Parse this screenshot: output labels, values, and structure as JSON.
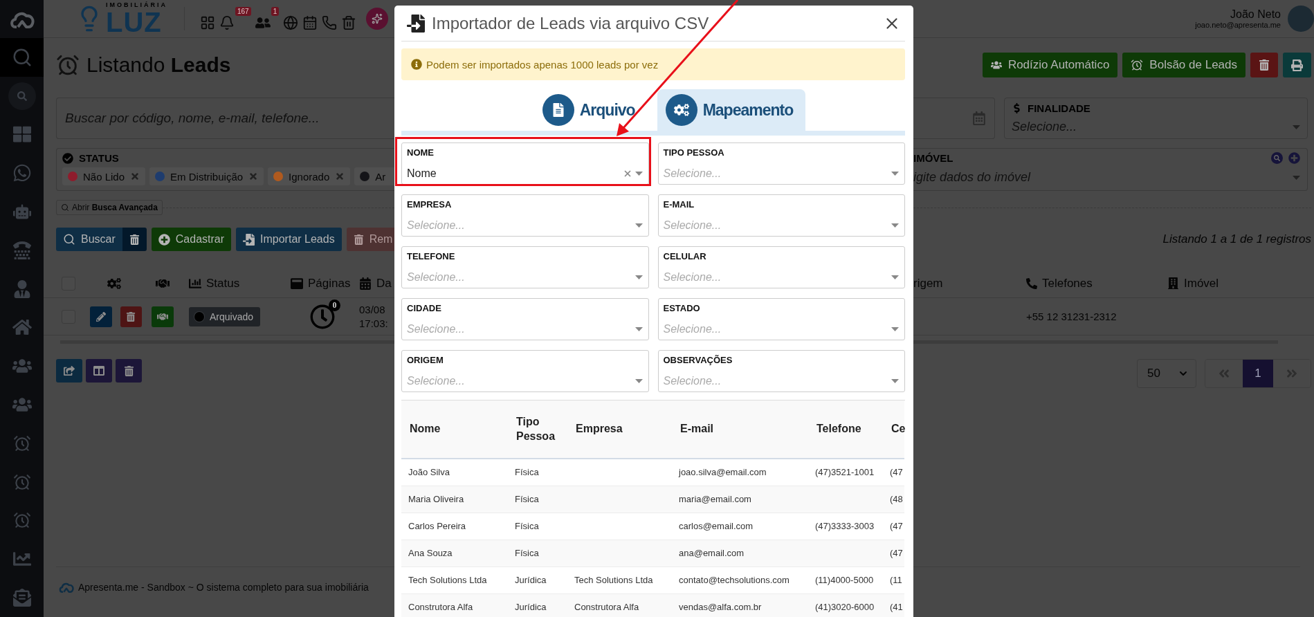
{
  "topbar": {
    "brand_tagline": "IMOBILIÁRIA",
    "brand_name": "LUZ",
    "notification_badge": "167",
    "users_badge": "1",
    "user_name": "João Neto",
    "user_email": "joao.neto@apresenta.me"
  },
  "sidebar": {
    "items": [
      {
        "kind": "search",
        "selected": true
      },
      {
        "kind": "quick-search",
        "selected": false
      },
      {
        "kind": "dashboard",
        "selected": false
      },
      {
        "kind": "whatsapp",
        "selected": false
      },
      {
        "kind": "robot",
        "selected": false
      },
      {
        "kind": "phone",
        "selected": false
      },
      {
        "kind": "agent",
        "selected": false
      },
      {
        "kind": "home",
        "selected": false
      },
      {
        "kind": "team",
        "selected": false
      },
      {
        "kind": "team",
        "selected": false
      },
      {
        "kind": "leads",
        "selected": false
      },
      {
        "kind": "leads",
        "selected": false
      },
      {
        "kind": "leads",
        "selected": false
      },
      {
        "kind": "chart",
        "selected": false
      },
      {
        "kind": "mail",
        "selected": false
      }
    ]
  },
  "page_title": "Listando **Leads**",
  "header_buttons": [
    {
      "kind": "rotation",
      "label": "Rodízio Automático"
    },
    {
      "kind": "pool",
      "label": "Bolsão de Leads"
    },
    {
      "kind": "delete"
    },
    {
      "kind": "print"
    }
  ],
  "search": {
    "placeholder": "Buscar por código, nome, e-mail, telefone..."
  },
  "purpose_filter": {
    "label": "FINALIDADE",
    "placeholder": "Selecione..."
  },
  "status_filter": {
    "label": "STATUS",
    "chips": [
      {
        "label": "Não Lido",
        "color": "#8e1c2c",
        "removable": true
      },
      {
        "label": "Em Distribuição",
        "color": "#1e3c6e",
        "removable": true
      },
      {
        "label": "Ignorado",
        "color": "#b05a1e",
        "removable": true
      },
      {
        "label": "Ar",
        "color": "#141418",
        "removable": false
      }
    ]
  },
  "property_filter": {
    "label": "IMÓVEL",
    "placeholder": "igite dados do imóvel"
  },
  "advanced_search": "Abrir **Busca Avançada**",
  "actions": [
    {
      "kind": "search",
      "label": "Buscar"
    },
    {
      "kind": "clear"
    },
    {
      "kind": "create",
      "label": "Cadastrar"
    },
    {
      "kind": "import",
      "label": "Importar Leads"
    },
    {
      "kind": "remove",
      "label": "Rem"
    }
  ],
  "listing_info": "Listando 1 a 1 de 1 registros",
  "table": {
    "columns_left": [
      {
        "kind": "select",
        "checked": false
      },
      {
        "kind": "actions"
      },
      {
        "kind": "deal"
      },
      {
        "kind": "status",
        "label": "Status"
      },
      {
        "kind": "pages",
        "label": "Páginas"
      },
      {
        "kind": "date",
        "label": "Da"
      }
    ],
    "columns_right": [
      {
        "kind": "origin",
        "label": "rigem"
      },
      {
        "kind": "phones",
        "label": "Telefones"
      },
      {
        "kind": "property",
        "label": "Imóvel"
      }
    ],
    "rows": [
      {
        "checked": false,
        "status": "Arquivado",
        "page_views": "0",
        "date": "03/08",
        "time": "17:03:",
        "phone": "+55 12 31231-2312"
      }
    ]
  },
  "pagination": {
    "page_size": "50",
    "pages": [
      {
        "label": "1",
        "selected": true
      }
    ]
  },
  "footer": "Apresenta.me - Sandbox ~ O sistema completo para sua imobiliária",
  "modal": {
    "title": "Importador de Leads via arquivo CSV",
    "notice": "Podem ser importados apenas 1000 leads por vez",
    "tabs": [
      {
        "kind": "file",
        "label": "Arquivo",
        "selected": false
      },
      {
        "kind": "mapping",
        "label": "Mapeamento",
        "selected": true
      }
    ],
    "fields": [
      {
        "label": "NOME",
        "value": "Nome",
        "highlighted": true
      },
      {
        "label": "TIPO PESSOA",
        "placeholder": "Selecione...",
        "highlighted": false
      },
      {
        "label": "EMPRESA",
        "placeholder": "Selecione...",
        "highlighted": false
      },
      {
        "label": "E-MAIL",
        "placeholder": "Selecione...",
        "highlighted": false
      },
      {
        "label": "TELEFONE",
        "placeholder": "Selecione...",
        "highlighted": false
      },
      {
        "label": "CELULAR",
        "placeholder": "Selecione...",
        "highlighted": false
      },
      {
        "label": "CIDADE",
        "placeholder": "Selecione...",
        "highlighted": false
      },
      {
        "label": "ESTADO",
        "placeholder": "Selecione...",
        "highlighted": false
      },
      {
        "label": "ORIGEM",
        "placeholder": "Selecione...",
        "highlighted": false
      },
      {
        "label": "OBSERVAÇÕES",
        "placeholder": "Selecione...",
        "highlighted": false
      }
    ],
    "preview": {
      "columns": [
        "Nome",
        "Tipo Pessoa",
        "Empresa",
        "E-mail",
        "Telefone",
        "Ce"
      ],
      "rows": [
        [
          "João Silva",
          "Física",
          "",
          "joao.silva@email.com",
          "(47)3521-1001",
          "(47"
        ],
        [
          "Maria Oliveira",
          "Física",
          "",
          "maria@email.com",
          "",
          "(48"
        ],
        [
          "Carlos Pereira",
          "Física",
          "",
          "carlos@email.com",
          "(47)3333-3003",
          "(47"
        ],
        [
          "Ana Souza",
          "Física",
          "",
          "ana@email.com",
          "",
          "(47"
        ],
        [
          "Tech Solutions Ltda",
          "Jurídica",
          "Tech Solutions Ltda",
          "contato@techsolutions.com",
          "(11)4000-5000",
          "(11"
        ],
        [
          "Construtora Alfa",
          "Jurídica",
          "Construtora Alfa",
          "vendas@alfa.com.br",
          "(41)3020-6000",
          "(41"
        ]
      ]
    }
  }
}
